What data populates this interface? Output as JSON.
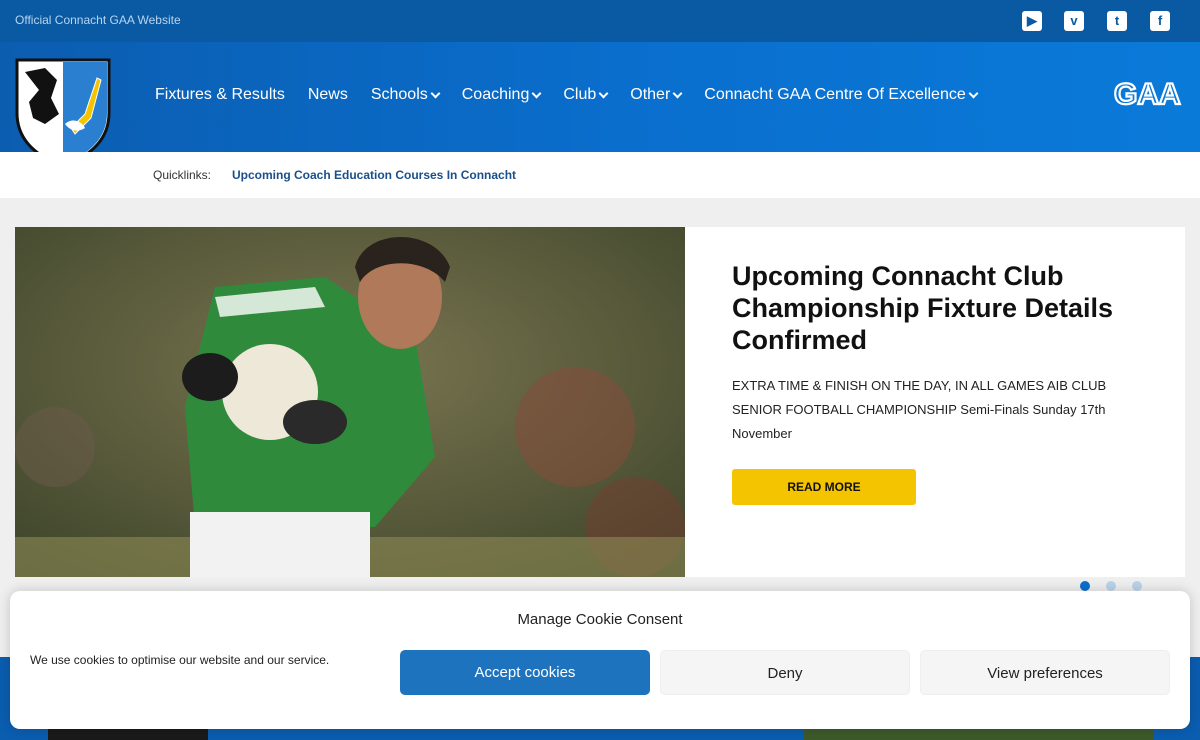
{
  "topbar": {
    "tagline": "Official Connacht GAA Website",
    "social": [
      {
        "icon": "youtube-icon",
        "glyph": "▶"
      },
      {
        "icon": "vimeo-icon",
        "glyph": "v"
      },
      {
        "icon": "twitter-icon",
        "glyph": "t"
      },
      {
        "icon": "facebook-icon",
        "glyph": "f"
      }
    ]
  },
  "nav": {
    "items": [
      {
        "label": "Fixtures & Results",
        "dropdown": false
      },
      {
        "label": "News",
        "dropdown": false
      },
      {
        "label": "Schools",
        "dropdown": true
      },
      {
        "label": "Coaching",
        "dropdown": true
      },
      {
        "label": "Club",
        "dropdown": true
      },
      {
        "label": "Other",
        "dropdown": true
      },
      {
        "label": "Connacht GAA Centre Of Excellence",
        "dropdown": true
      }
    ],
    "brand_text": "GAA"
  },
  "quicklinks": {
    "label": "Quicklinks:",
    "link": "Upcoming Coach Education Courses In Connacht"
  },
  "hero": {
    "title": "Upcoming Connacht Club Championship Fixture Details Confirmed",
    "text": "EXTRA TIME & FINISH ON THE DAY, IN ALL GAMES   AIB CLUB SENIOR FOOTBALL CHAMPIONSHIP Semi-Finals Sunday 17th November",
    "button": "READ MORE",
    "slides": 3,
    "active_slide": 1
  },
  "cookie": {
    "title": "Manage Cookie Consent",
    "message": "We use cookies to optimise our website and our service.",
    "accept": "Accept cookies",
    "deny": "Deny",
    "preferences": "View preferences"
  },
  "colors": {
    "primary_blue": "#0a6fce",
    "yellow": "#f5c400",
    "accept_blue": "#1e73be"
  }
}
